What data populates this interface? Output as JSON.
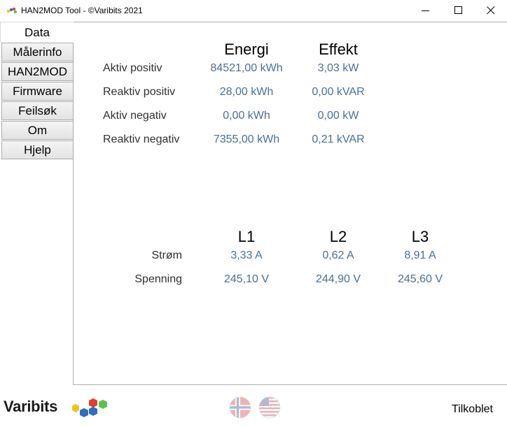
{
  "window": {
    "title": "HAN2MOD Tool - ©Varibits 2021"
  },
  "tabs": {
    "active": "Data",
    "items": [
      "Målerinfo",
      "HAN2MOD",
      "Firmware",
      "Feilsøk",
      "Om",
      "Hjelp"
    ]
  },
  "energy_table": {
    "col_energi": "Energi",
    "col_effekt": "Effekt",
    "rows": [
      {
        "label": "Aktiv positiv",
        "energi": "84521,00 kWh",
        "effekt": "3,03 kW"
      },
      {
        "label": "Reaktiv positiv",
        "energi": "28,00 kWh",
        "effekt": "0,00 kVAR"
      },
      {
        "label": "Aktiv negativ",
        "energi": "0,00 kWh",
        "effekt": "0,00 kW"
      },
      {
        "label": "Reaktiv negativ",
        "energi": "7355,00 kWh",
        "effekt": "0,21 kVAR"
      }
    ]
  },
  "phase_table": {
    "col_l1": "L1",
    "col_l2": "L2",
    "col_l3": "L3",
    "rows": [
      {
        "label": "Strøm",
        "l1": "3,33 A",
        "l2": "0,62 A",
        "l3": "8,91 A"
      },
      {
        "label": "Spenning",
        "l1": "245,10 V",
        "l2": "244,90 V",
        "l3": "245,60 V"
      }
    ]
  },
  "footer": {
    "logo_text": "Varibits",
    "status": "Tilkoblet"
  },
  "icons": {
    "app": "han2mod-app-icon",
    "minimize": "minimize-icon",
    "maximize": "maximize-icon",
    "close": "close-icon",
    "flag_norway": "norway-flag-icon",
    "flag_usa": "usa-flag-icon"
  },
  "colors": {
    "value_text": "#4a6f95",
    "logo_hex_yellow": "#f2c21b",
    "logo_hex_blue": "#2f6ec2",
    "logo_hex_red": "#e0402f",
    "logo_hex_green": "#5cc144"
  }
}
